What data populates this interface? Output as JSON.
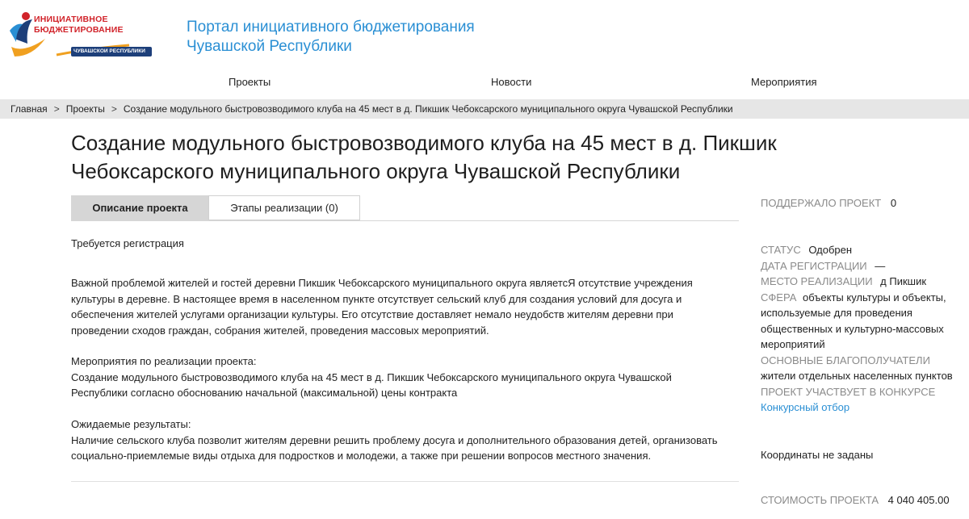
{
  "logo": {
    "line1": "ИНИЦИАТИВНОЕ",
    "line2": "БЮДЖЕТИРОВАНИЕ",
    "ribbon": "ЧУВАШСКОЙ РЕСПУБЛИКИ"
  },
  "portal": {
    "title_line1": "Портал инициативного бюджетирования",
    "title_line2": "Чувашской Республики"
  },
  "nav": {
    "projects": "Проекты",
    "news": "Новости",
    "events": "Мероприятия"
  },
  "breadcrumb": {
    "home": "Главная",
    "projects": "Проекты",
    "current": "Создание модульного быстровозводимого клуба на 45 мест в д. Пикшик Чебоксарского муниципального округа Чувашской Республики",
    "separator": ">"
  },
  "page": {
    "title_line1": "Создание модульного быстровозводимого клуба на 45 мест в д. Пикшик",
    "title_line2": "Чебоксарского муниципального округа Чувашской Республики"
  },
  "tabs": {
    "description": "Описание проекта",
    "stages": "Этапы реализации (0)"
  },
  "content": {
    "registration_required": "Требуется регистрация",
    "problem": [
      "Важной проблемой жителей и гостей деревни Пикшик Чебоксарского муниципального округа являетсЯ отсутствие учреждения",
      "культуры в деревне. В настоящее время в населенном пункте отсутствует сельский клуб для создания условий для досуга и",
      "обеспечения жителей услугами организации культуры. Его отсутствие доставляет немало неудобств жителям деревни при",
      "проведении сходов граждан, собрания жителей, проведения массовых мероприятий."
    ],
    "measures_heading": "Мероприятия по реализации проекта:",
    "measures": [
      "Создание модульного быстровозводимого клуба на 45 мест в д. Пикшик Чебоксарского муниципального округа Чувашской",
      "Республики согласно обоснованию начальной (максимальной) цены контракта"
    ],
    "results_heading": "Ожидаемые результаты:",
    "results": [
      "Наличие сельского клуба позволит жителям деревни решить проблему досуга и дополнительного образования детей, организовать",
      "социально-приемлемые виды отдыха для подростков и молодежи, а также при решении вопросов местного значения."
    ]
  },
  "sidebar": {
    "supported_label": "ПОДДЕРЖАЛО ПРОЕКТ",
    "supported_value": "0",
    "status_label": "СТАТУС",
    "status_value": "Одобрен",
    "reg_date_label": "ДАТА РЕГИСТРАЦИИ",
    "reg_date_value": "—",
    "place_label": "МЕСТО РЕАЛИЗАЦИИ",
    "place_value": "д Пикшик",
    "sphere_label": "СФЕРА",
    "sphere_value_line1": "объекты культуры и объекты,",
    "sphere_value_rest": [
      "используемые для проведения",
      "общественных и культурно-массовых",
      "мероприятий"
    ],
    "beneficiaries_label": "ОСНОВНЫЕ БЛАГОПОЛУЧАТЕЛИ",
    "beneficiaries_value": "жители отдельных населенных пунктов",
    "contest_label": "ПРОЕКТ УЧАСТВУЕТ В КОНКУРСЕ",
    "contest_link": "Конкурсный отбор",
    "coordinates": "Координаты не заданы",
    "cost_label": "СТОИМОСТЬ ПРОЕКТА",
    "cost_value": "4 040 405.00"
  },
  "colors": {
    "accent": "#2a8fd4",
    "logo_red": "#d1232a",
    "logo_navy": "#1d3f7a",
    "logo_orange": "#f0a020",
    "tab_active_bg": "#d6d6d6",
    "breadcrumb_bg": "#e6e6e6",
    "label_gray": "#8a8a8a"
  }
}
